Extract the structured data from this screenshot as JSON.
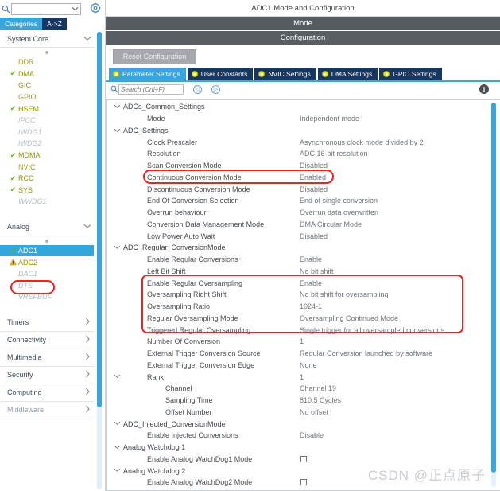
{
  "sidebar": {
    "search": {
      "value": "",
      "icon": "search-icon"
    },
    "gear_icon": "gear-icon",
    "tabs": [
      {
        "label": "Categories",
        "active": true
      },
      {
        "label": "A->Z",
        "active": false
      }
    ],
    "groups": [
      {
        "title": "System Core",
        "expanded": true,
        "caret": "chevron-down-icon",
        "items": [
          {
            "label": "DDR",
            "state": "plain"
          },
          {
            "label": "DMA",
            "state": "check"
          },
          {
            "label": "GIC",
            "state": "plain"
          },
          {
            "label": "GPIO",
            "state": "plain"
          },
          {
            "label": "HSEM",
            "state": "check"
          },
          {
            "label": "IPCC",
            "state": "dim"
          },
          {
            "label": "IWDG1",
            "state": "dim"
          },
          {
            "label": "IWDG2",
            "state": "dim"
          },
          {
            "label": "MDMA",
            "state": "check"
          },
          {
            "label": "NVIC",
            "state": "plain"
          },
          {
            "label": "RCC",
            "state": "check"
          },
          {
            "label": "SYS",
            "state": "check"
          },
          {
            "label": "WWDG1",
            "state": "dim"
          }
        ]
      },
      {
        "title": "Analog",
        "expanded": true,
        "caret": "chevron-down-icon",
        "items": [
          {
            "label": "ADC1",
            "state": "check",
            "selected": true
          },
          {
            "label": "ADC2",
            "state": "warn"
          },
          {
            "label": "DAC1",
            "state": "dim"
          },
          {
            "label": "DTS",
            "state": "dim"
          },
          {
            "label": "VREFBUF",
            "state": "dim"
          }
        ]
      },
      {
        "title": "Timers",
        "expanded": false,
        "caret": "chevron-right-icon",
        "items": []
      },
      {
        "title": "Connectivity",
        "expanded": false,
        "caret": "chevron-right-icon",
        "items": []
      },
      {
        "title": "Multimedia",
        "expanded": false,
        "caret": "chevron-right-icon",
        "items": []
      },
      {
        "title": "Security",
        "expanded": false,
        "caret": "chevron-right-icon",
        "items": []
      },
      {
        "title": "Computing",
        "expanded": false,
        "caret": "chevron-right-icon",
        "items": []
      },
      {
        "title": "Middleware",
        "expanded": false,
        "caret": "chevron-right-icon",
        "items": [],
        "faded": true
      }
    ]
  },
  "main": {
    "title": "ADC1 Mode and Configuration",
    "mode_bar": "Mode",
    "configuration_bar": "Configuration",
    "reset_button": "Reset Configuration",
    "tabs": [
      {
        "label": "Parameter Settings",
        "active": true
      },
      {
        "label": "User Constants",
        "active": false
      },
      {
        "label": "NVIC Settings",
        "active": false
      },
      {
        "label": "DMA Settings",
        "active": false
      },
      {
        "label": "GPIO Settings",
        "active": false
      }
    ],
    "search": {
      "placeholder": "Search (Crtl+F)",
      "value": ""
    },
    "nav_prev_icon": "chevron-left-circle-icon",
    "nav_next_icon": "chevron-right-circle-icon",
    "info_icon": "info-icon",
    "tree": [
      {
        "kind": "grp",
        "name": "ADCs_Common_Settings",
        "value": "",
        "caret": "chevron-down-icon"
      },
      {
        "kind": "itm",
        "name": "Mode",
        "value": "Independent mode"
      },
      {
        "kind": "grp",
        "name": "ADC_Settings",
        "value": "",
        "caret": "chevron-down-icon"
      },
      {
        "kind": "itm",
        "name": "Clock Prescaler",
        "value": "Asynchronous clock mode divided by 2"
      },
      {
        "kind": "itm",
        "name": "Resolution",
        "value": "ADC 16-bit resolution"
      },
      {
        "kind": "itm",
        "name": "Scan Conversion Mode",
        "value": "Disabled"
      },
      {
        "kind": "itm",
        "name": "Continuous Conversion Mode",
        "value": "Enabled"
      },
      {
        "kind": "itm",
        "name": "Discontinuous Conversion Mode",
        "value": "Disabled"
      },
      {
        "kind": "itm",
        "name": "End Of Conversion Selection",
        "value": "End of single conversion"
      },
      {
        "kind": "itm",
        "name": "Overrun behaviour",
        "value": "Overrun data overwritten"
      },
      {
        "kind": "itm",
        "name": "Conversion Data Management Mode",
        "value": "DMA Circular Mode"
      },
      {
        "kind": "itm",
        "name": "Low Power Auto Wait",
        "value": "Disabled"
      },
      {
        "kind": "grp",
        "name": "ADC_Regular_ConversionMode",
        "value": "",
        "caret": "chevron-down-icon"
      },
      {
        "kind": "itm",
        "name": "Enable Regular Conversions",
        "value": "Enable"
      },
      {
        "kind": "itm",
        "name": "Left Bit Shift",
        "value": "No bit shift"
      },
      {
        "kind": "itm",
        "name": "Enable Regular Oversampling",
        "value": "Enable"
      },
      {
        "kind": "itm",
        "name": "Oversampling Right Shift",
        "value": "No bit shift for oversampling"
      },
      {
        "kind": "itm",
        "name": "Oversampling Ratio",
        "value": "1024-1"
      },
      {
        "kind": "itm",
        "name": "Regular Oversampling Mode",
        "value": "Oversampling Continued Mode"
      },
      {
        "kind": "itm",
        "name": "Triggered Regular Oversampling",
        "value": "Single trigger for all oversampled conversions"
      },
      {
        "kind": "itm",
        "name": "Number Of Conversion",
        "value": "1"
      },
      {
        "kind": "itm",
        "name": "External Trigger Conversion Source",
        "value": "Regular Conversion launched by software"
      },
      {
        "kind": "itm",
        "name": "External Trigger Conversion Edge",
        "value": "None"
      },
      {
        "kind": "itm",
        "name": "Rank",
        "value": "1",
        "caret": "chevron-down-icon"
      },
      {
        "kind": "itm2",
        "name": "Channel",
        "value": "Channel 19"
      },
      {
        "kind": "itm2",
        "name": "Sampling Time",
        "value": "810.5 Cycles"
      },
      {
        "kind": "itm2",
        "name": "Offset Number",
        "value": "No offset"
      },
      {
        "kind": "grp",
        "name": "ADC_Injected_ConversionMode",
        "value": "",
        "caret": "chevron-down-icon"
      },
      {
        "kind": "itm",
        "name": "Enable Injected Conversions",
        "value": "Disable"
      },
      {
        "kind": "grp",
        "name": "Analog Watchdog 1",
        "value": "",
        "caret": "chevron-down-icon"
      },
      {
        "kind": "itm",
        "name": "Enable Analog WatchDog1 Mode",
        "value": "",
        "checkbox": true
      },
      {
        "kind": "grp",
        "name": "Analog Watchdog 2",
        "value": "",
        "caret": "chevron-down-icon"
      },
      {
        "kind": "itm",
        "name": "Enable Analog WatchDog2 Mode",
        "value": "",
        "checkbox": true
      }
    ]
  },
  "annotations": {
    "color": "#ee2222",
    "shapes": [
      {
        "name": "adc1-highlight",
        "type": "ellipse"
      },
      {
        "name": "continuous-conversion-highlight",
        "type": "ellipse"
      },
      {
        "name": "oversampling-block-highlight",
        "type": "rounded-rect"
      }
    ]
  },
  "watermark": "CSDN @正点原子"
}
